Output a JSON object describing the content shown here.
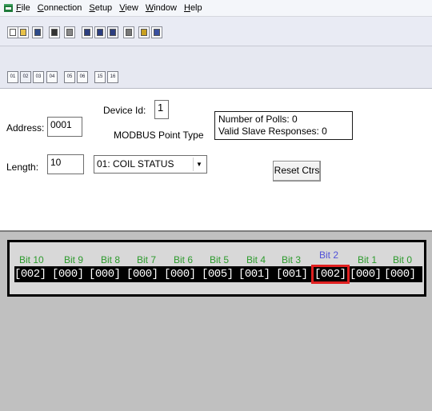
{
  "menu": {
    "items": [
      {
        "label": "File",
        "u": "F",
        "rest": "ile"
      },
      {
        "label": "Connection",
        "u": "C",
        "rest": "onnection"
      },
      {
        "label": "Setup",
        "u": "S",
        "rest": "etup"
      },
      {
        "label": "View",
        "u": "V",
        "rest": "iew"
      },
      {
        "label": "Window",
        "u": "W",
        "rest": "indow"
      },
      {
        "label": "Help",
        "u": "H",
        "rest": "elp"
      }
    ]
  },
  "toolbar1": {
    "icons": [
      "new-doc-icon",
      "open-folder-icon",
      "save-icon",
      "connect-icon",
      "disconnect-icon",
      "poll-icon",
      "read-icon",
      "write-icon",
      "print-icon",
      "help-icon",
      "context-help-icon"
    ]
  },
  "toolbar2": {
    "buttons": [
      "01",
      "02",
      "03",
      "04",
      "05",
      "06",
      "15",
      "16"
    ]
  },
  "form": {
    "device_id_label": "Device Id:",
    "device_id_value": "1",
    "address_label": "Address:",
    "address_value": "0001",
    "point_type_label": "MODBUS Point Type",
    "length_label": "Length:",
    "length_value": "10",
    "point_type_value": "01: COIL STATUS"
  },
  "stats": {
    "polls": "Number of Polls: 0",
    "responses": "Valid Slave Responses: 0",
    "reset_label": "Reset Ctrs"
  },
  "bits": {
    "labels": [
      "Bit 10",
      "Bit 9",
      "Bit 8",
      "Bit 7",
      "Bit 6",
      "Bit 5",
      "Bit 4",
      "Bit 3",
      "Bit 2",
      "Bit 1",
      "Bit 0"
    ],
    "values": [
      "[002]",
      "[000]",
      "[000]",
      "[000]",
      "[000]",
      "[005]",
      "[001]",
      "[001]",
      "[002]",
      "[000]",
      "[000]"
    ],
    "selected_index": 8,
    "label_color": "#2c9a2c",
    "selected_label_color": "#5050d8",
    "highlight_color": "#e02020"
  }
}
